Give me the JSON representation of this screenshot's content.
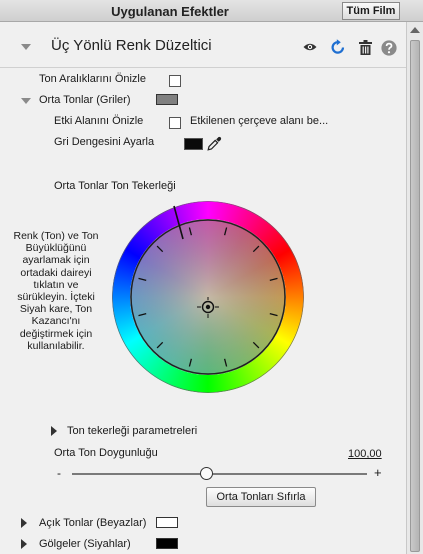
{
  "panel": {
    "title": "Uygulanan Efektler",
    "view_all_button": "Tüm Film"
  },
  "effect": {
    "name": "Üç Yönlü Renk Düzeltici",
    "icons": [
      "eye-icon",
      "reset-icon",
      "trash-icon",
      "help-icon"
    ]
  },
  "options": {
    "preview_ranges_label": "Ton Aralıklarını Önizle",
    "midtones_label": "Orta Tonlar (Griler)",
    "preview_affected_label": "Etki Alanını Önizle",
    "preview_affected_desc": "Etkilenen çerçeve alanı be...",
    "gray_balance_label": "Gri Dengesini Ayarla"
  },
  "wheel": {
    "title": "Orta Tonlar Ton Tekerleği",
    "help_text": "Renk (Ton) ve Ton Büyüklüğünü ayarlamak için ortadaki daireyi tıklatın ve sürükleyin. İçteki Siyah kare, Ton Kazancı'nı değiştirmek için kullanılabilir.",
    "parameters_label": "Ton tekerleği parametreleri"
  },
  "saturation": {
    "label": "Orta Ton Doygunluğu",
    "value_text": "100,00",
    "minus": "-",
    "plus": "+",
    "level": 0.5
  },
  "reset_button": "Orta Tonları Sıfırla",
  "sections": {
    "highlights_label": "Açık Tonlar (Beyazlar)",
    "shadows_label": "Gölgeler (Siyahlar)"
  },
  "colors": {
    "midtone_swatch": "#808080",
    "highlight_swatch": "#ffffff",
    "shadow_swatch": "#000000",
    "gray_balance_swatch": "#0a0a0a",
    "accent": "#1f6fd1"
  }
}
